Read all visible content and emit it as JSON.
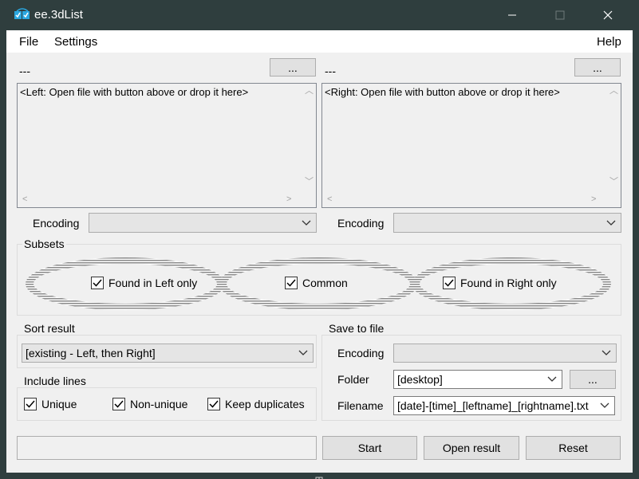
{
  "window": {
    "title": "ee.3dList"
  },
  "menu": {
    "file": "File",
    "settings": "Settings",
    "help": "Help"
  },
  "left": {
    "path": "---",
    "browse": "...",
    "placeholder": "<Left: Open file with button above or drop it here>",
    "encoding_label": "Encoding"
  },
  "right": {
    "path": "---",
    "browse": "...",
    "placeholder": "<Right: Open file with button above or drop it here>",
    "encoding_label": "Encoding"
  },
  "subsets": {
    "title": "Subsets",
    "left_only": "Found in Left only",
    "common": "Common",
    "right_only": "Found in Right only"
  },
  "sort": {
    "title": "Sort result",
    "value": "[existing - Left, then Right]"
  },
  "include": {
    "title": "Include lines",
    "unique": "Unique",
    "non_unique": "Non-unique",
    "keep_duplicates": "Keep duplicates"
  },
  "save": {
    "title": "Save to file",
    "encoding_label": "Encoding",
    "folder_label": "Folder",
    "folder_value": "[desktop]",
    "folder_browse": "...",
    "filename_label": "Filename",
    "filename_value": "[date]-[time]_[leftname]_[rightname].txt"
  },
  "actions": {
    "start": "Start",
    "open_result": "Open result",
    "reset": "Reset"
  },
  "colors": {
    "titlebar": "#2f3e3e",
    "panel": "#f0f0f0",
    "accent": "#1e90ff"
  }
}
